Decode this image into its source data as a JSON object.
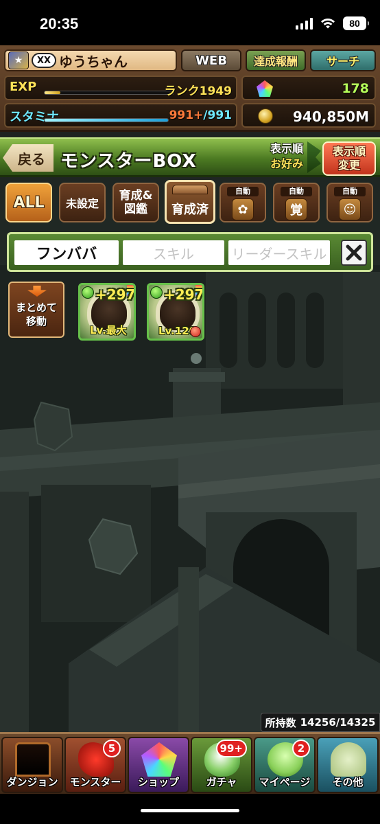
{
  "status_bar": {
    "time": "20:35",
    "battery": "80",
    "icons": [
      "signal-icon",
      "wifi-icon",
      "battery-icon"
    ]
  },
  "player": {
    "badge": "XX",
    "name": "ゆうちゃん"
  },
  "top_buttons": {
    "web": "WEB",
    "achievements": "達成報酬",
    "search": "サーチ"
  },
  "stats": {
    "exp_label": "EXP",
    "exp_fill": 0.12,
    "rank_text": "ランク1949",
    "stamina_label": "スタミナ",
    "stamina_fill": 1.0,
    "stamina_current": "991+",
    "stamina_max": "/991",
    "magic_stones": "178",
    "coins": "940,850M"
  },
  "title_bar": {
    "back_label": "戻る",
    "title": "モンスターBOX",
    "sort_line1": "表示順",
    "sort_line2": "お好み",
    "sort_button_line1": "表示順",
    "sort_button_line2": "変更"
  },
  "tabs": {
    "all": "ALL",
    "unset": "未設定",
    "guide_line1": "育成&",
    "guide_line2": "図鑑",
    "raised": "育成済",
    "auto1": "自動",
    "auto2": "自動",
    "auto3": "自動",
    "auto2_glyph": "覚"
  },
  "search": {
    "name_value": "フンババ",
    "skill_placeholder": "スキル",
    "leader_placeholder": "リーダースキル"
  },
  "group_move": {
    "line1": "まとめて",
    "line2": "移動"
  },
  "monsters": [
    {
      "plus": "+297",
      "level": "Lv.最大"
    },
    {
      "plus": "+297",
      "level": "Lv.120"
    }
  ],
  "box_count": {
    "label": "所持数",
    "value": "14256/14325"
  },
  "bottom_nav": [
    {
      "label": "ダンジョン",
      "badge": ""
    },
    {
      "label": "モンスター",
      "badge": "5"
    },
    {
      "label": "ショップ",
      "badge": ""
    },
    {
      "label": "ガチャ",
      "badge": "99+"
    },
    {
      "label": "マイページ",
      "badge": "2"
    },
    {
      "label": "その他",
      "badge": ""
    }
  ]
}
